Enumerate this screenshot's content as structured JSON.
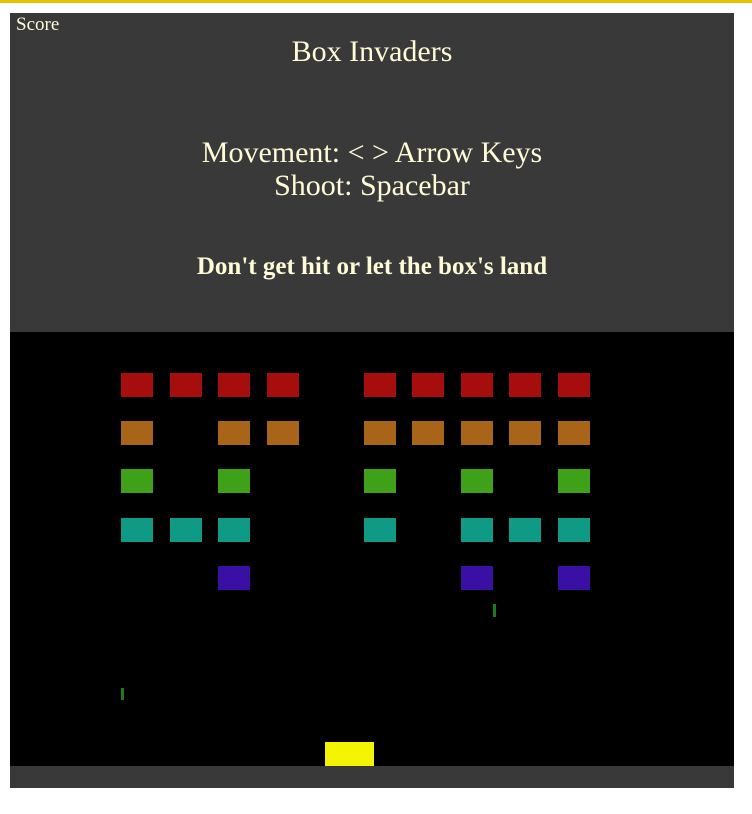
{
  "score_label": "Score",
  "title": "Box Invaders",
  "instructions": {
    "movement": "Movement: < > Arrow Keys",
    "shoot": "Shoot: Spacebar"
  },
  "warning": "Don't get hit or let the box's land",
  "colors": {
    "red": "#a60d0d",
    "orange": "#a8651a",
    "green": "#3ea118",
    "teal": "#0f9a86",
    "purple": "#3a0fa3",
    "player": "#f5f400",
    "background": "#000000",
    "panel": "#3a3939"
  },
  "invaders": {
    "rows": [
      {
        "color": "red",
        "present": [
          1,
          1,
          1,
          1,
          0,
          1,
          1,
          1,
          1,
          1
        ]
      },
      {
        "color": "orange",
        "present": [
          1,
          0,
          1,
          1,
          0,
          1,
          1,
          1,
          1,
          1
        ]
      },
      {
        "color": "green",
        "present": [
          1,
          0,
          1,
          0,
          0,
          1,
          0,
          1,
          0,
          1
        ]
      },
      {
        "color": "teal",
        "present": [
          1,
          1,
          1,
          0,
          0,
          1,
          0,
          1,
          1,
          1
        ]
      },
      {
        "color": "purple",
        "present": [
          0,
          0,
          1,
          0,
          0,
          0,
          0,
          1,
          0,
          1
        ]
      }
    ]
  }
}
